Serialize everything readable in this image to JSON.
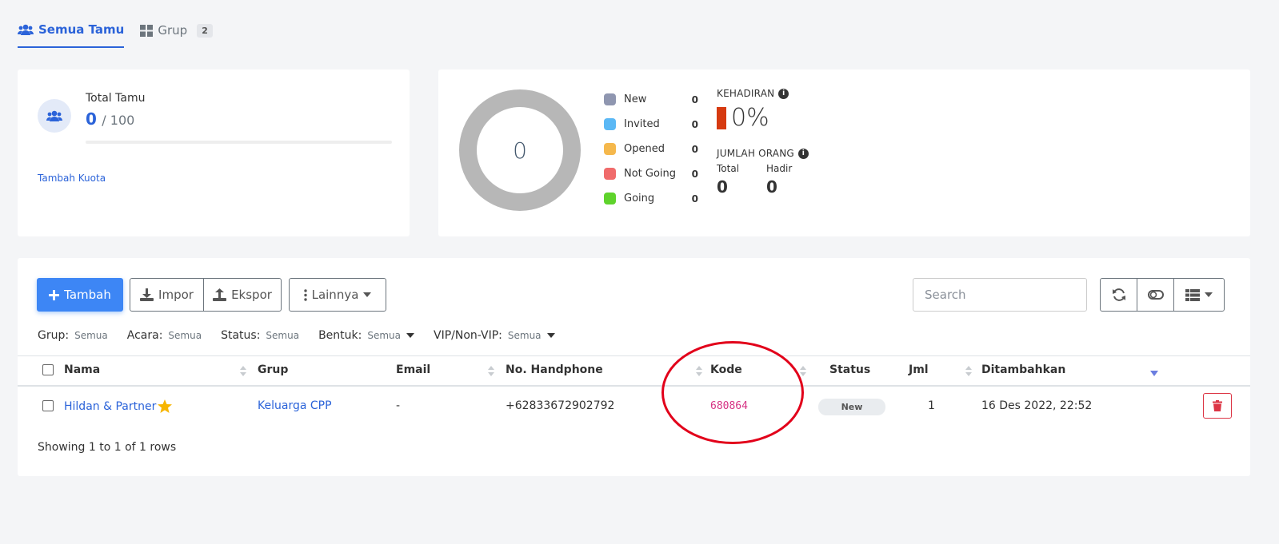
{
  "tabs": [
    {
      "label": "Semua Tamu",
      "icon": "users-icon"
    },
    {
      "label": "Grup",
      "icon": "grid-icon",
      "badge": "2"
    }
  ],
  "total": {
    "label": "Total Tamu",
    "current": "0",
    "separator": "/ 100",
    "progress": 0,
    "quota_link": "Tambah Kuota"
  },
  "stats": {
    "donut_value": "0",
    "legend": [
      {
        "name": "New",
        "count": "0",
        "color": "#8f96b0"
      },
      {
        "name": "Invited",
        "count": "0",
        "color": "#5bb8f5"
      },
      {
        "name": "Opened",
        "count": "0",
        "color": "#f5b84c"
      },
      {
        "name": "Not Going",
        "count": "0",
        "color": "#f06b6b"
      },
      {
        "name": "Going",
        "count": "0",
        "color": "#5fd32c"
      }
    ],
    "kehadiran_title": "KEHADIRAN",
    "kehadiran_value": "0%",
    "jumlah_title": "JUMLAH ORANG",
    "total_label": "Total",
    "total_value": "0",
    "hadir_label": "Hadir",
    "hadir_value": "0"
  },
  "toolbar": {
    "add_label": "Tambah",
    "import_label": "Impor",
    "export_label": "Ekspor",
    "more_label": "Lainnya",
    "search_placeholder": "Search"
  },
  "filters": [
    {
      "label": "Grup:",
      "value": "Semua",
      "dropdown": false
    },
    {
      "label": "Acara:",
      "value": "Semua",
      "dropdown": false
    },
    {
      "label": "Status:",
      "value": "Semua",
      "dropdown": false
    },
    {
      "label": "Bentuk:",
      "value": "Semua",
      "dropdown": true
    },
    {
      "label": "VIP/Non-VIP:",
      "value": "Semua",
      "dropdown": true
    }
  ],
  "columns": {
    "nama": "Nama",
    "grup": "Grup",
    "email": "Email",
    "phone": "No. Handphone",
    "kode": "Kode",
    "status": "Status",
    "jml": "Jml",
    "ditambahkan": "Ditambahkan"
  },
  "rows": [
    {
      "nama": "Hildan & Partner",
      "grup": "Keluarga CPP",
      "email": "-",
      "phone": "+62833672902792",
      "kode": "680864",
      "status": "New",
      "jml": "1",
      "ditambahkan": "16 Des 2022, 22:52"
    }
  ],
  "footer": "Showing 1 to 1 of 1 rows"
}
